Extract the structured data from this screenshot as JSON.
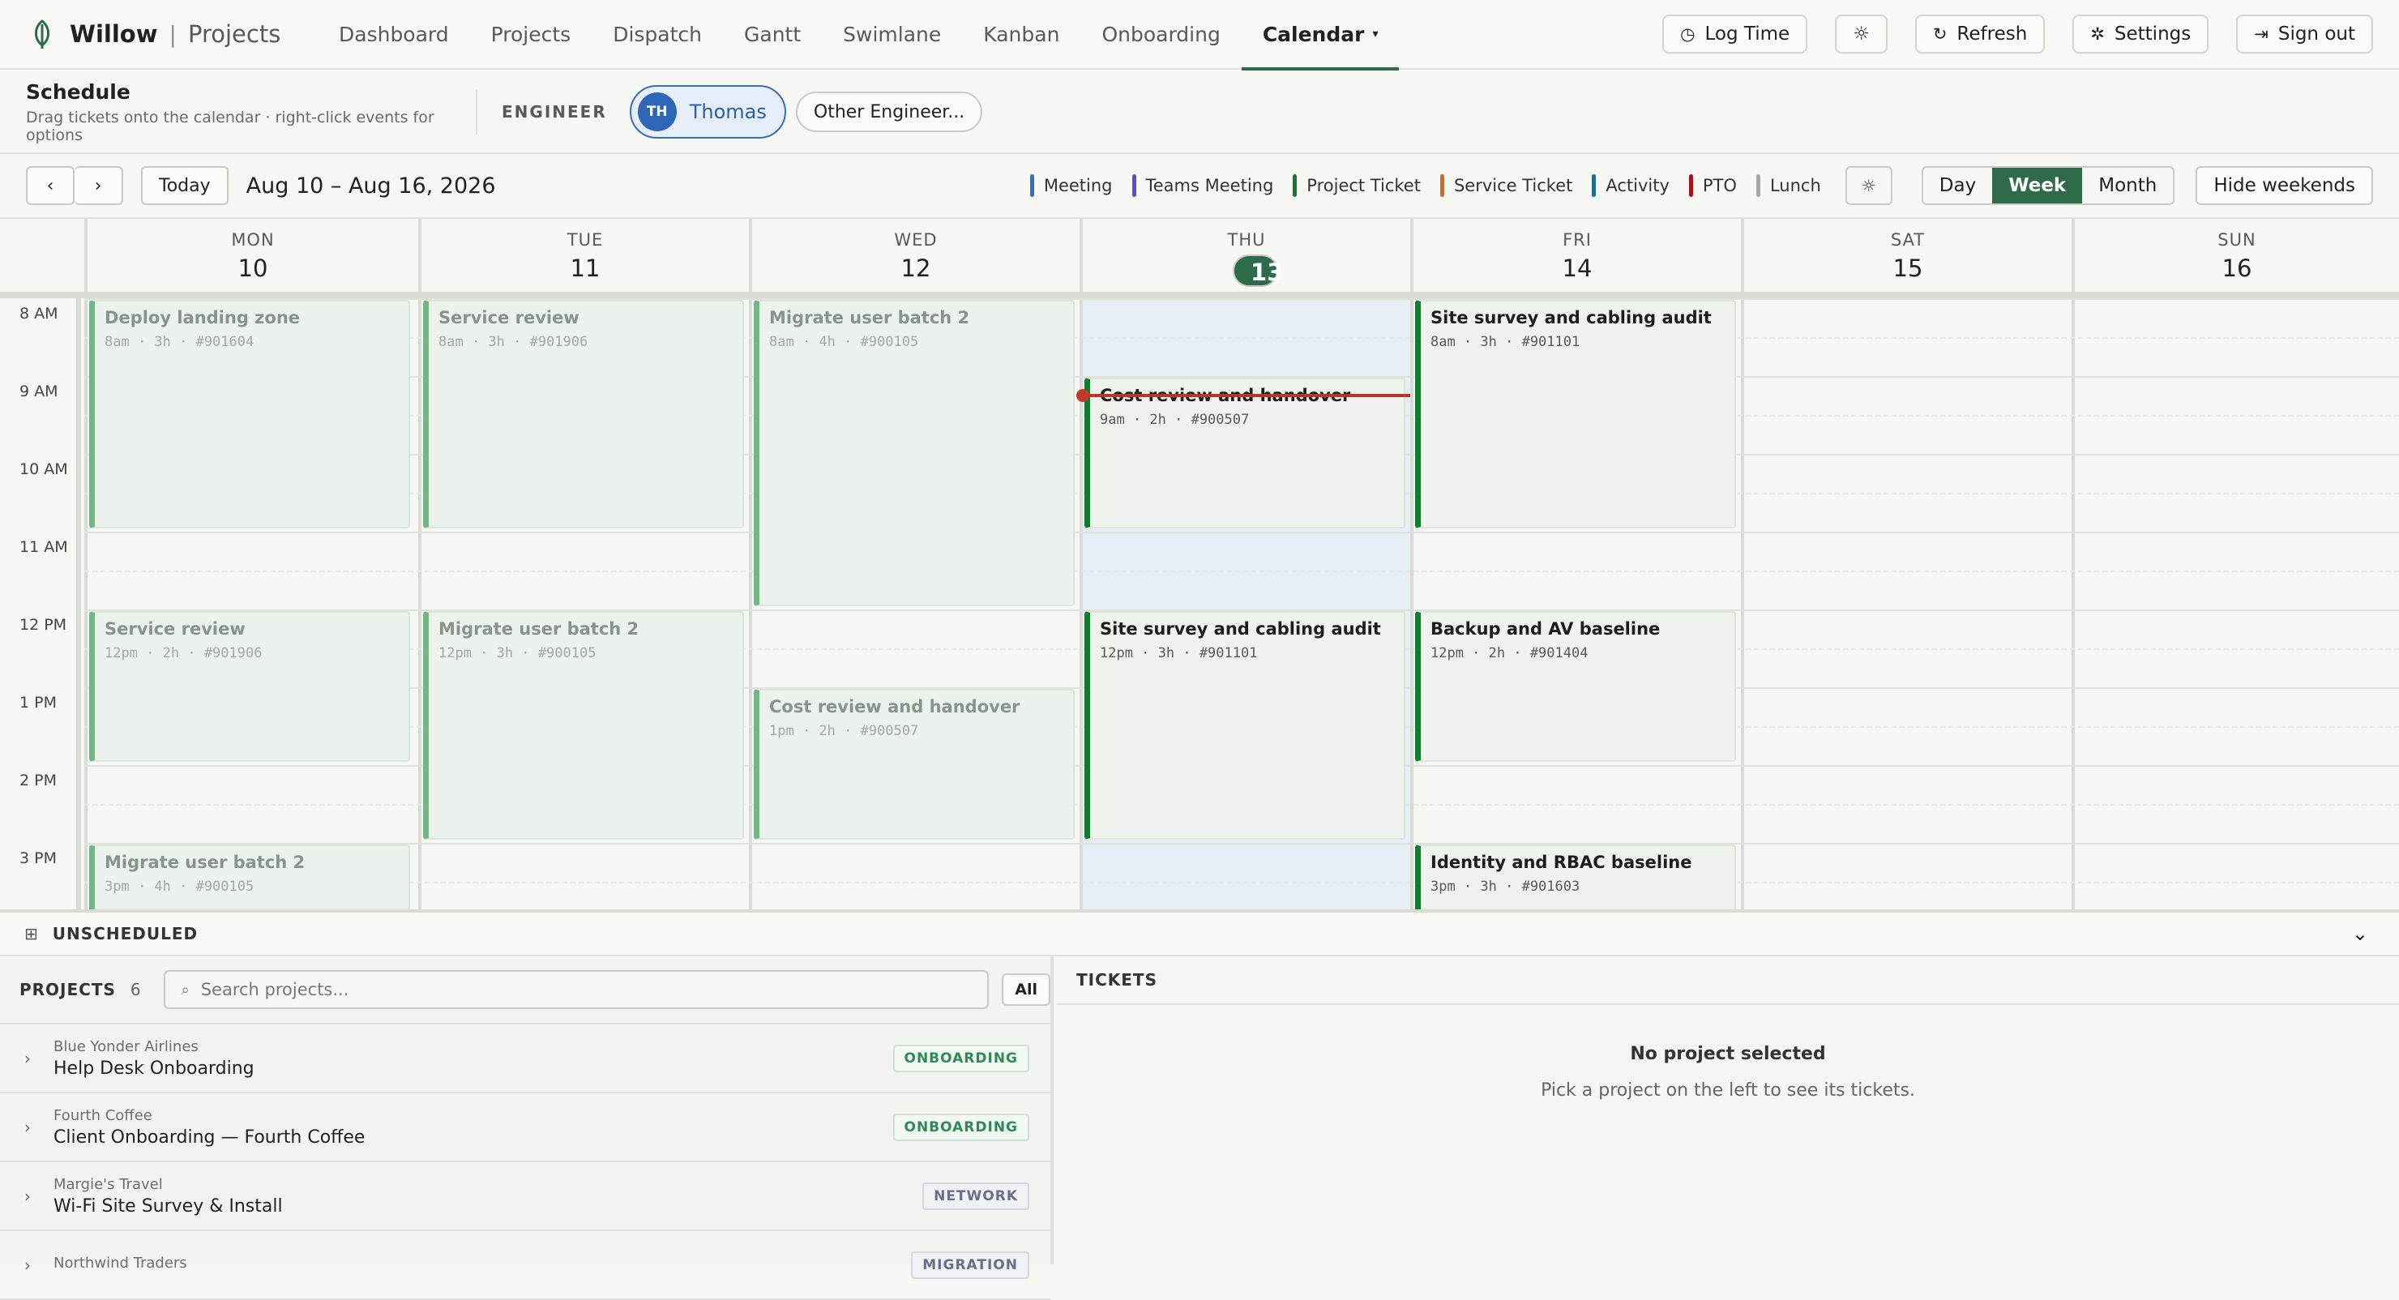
{
  "app": {
    "brand": "Willow",
    "name": "Projects"
  },
  "nav": {
    "tabs": [
      "Dashboard",
      "Projects",
      "Dispatch",
      "Gantt",
      "Swimlane",
      "Kanban",
      "Onboarding",
      "Calendar"
    ],
    "active": "Calendar"
  },
  "topbar": {
    "log_time": "Log Time",
    "refresh": "Refresh",
    "settings": "Settings",
    "sign_out": "Sign out"
  },
  "schedule": {
    "title": "Schedule",
    "subtitle": "Drag tickets onto the calendar · right-click events for options",
    "engineer_label": "ENGINEER",
    "engineer_initials": "TH",
    "engineer_name": "Thomas",
    "other": "Other Engineer..."
  },
  "calendar": {
    "today": "Today",
    "range": "Aug 10 – Aug 16, 2026",
    "legend": [
      {
        "label": "Meeting",
        "color": "#2f6fd1"
      },
      {
        "label": "Teams Meeting",
        "color": "#5b4fd0"
      },
      {
        "label": "Project Ticket",
        "color": "#137a2e"
      },
      {
        "label": "Service Ticket",
        "color": "#d9661f"
      },
      {
        "label": "Activity",
        "color": "#1f6f8b"
      },
      {
        "label": "PTO",
        "color": "#a3121f"
      },
      {
        "label": "Lunch",
        "color": "#a8a8a8"
      }
    ],
    "views": [
      "Day",
      "Week",
      "Month"
    ],
    "active_view": "Week",
    "hide_weekends": "Hide weekends",
    "days": [
      {
        "name": "MON",
        "date": "10"
      },
      {
        "name": "TUE",
        "date": "11"
      },
      {
        "name": "WED",
        "date": "12"
      },
      {
        "name": "THU",
        "date": "13",
        "today": true
      },
      {
        "name": "FRI",
        "date": "14"
      },
      {
        "name": "SAT",
        "date": "15"
      },
      {
        "name": "SUN",
        "date": "16"
      }
    ],
    "hours": [
      "8 AM",
      "9 AM",
      "10 AM",
      "11 AM",
      "12 PM",
      "1 PM",
      "2 PM",
      "3 PM"
    ],
    "events": [
      {
        "day": 0,
        "start": 8,
        "dur": 3,
        "title": "Deploy landing zone",
        "meta": "8am · 3h · #901604",
        "past": true
      },
      {
        "day": 0,
        "start": 12,
        "dur": 2,
        "title": "Service review",
        "meta": "12pm · 2h · #901906",
        "past": true
      },
      {
        "day": 0,
        "start": 15,
        "dur": 4,
        "title": "Migrate user batch 2",
        "meta": "3pm · 4h · #900105",
        "past": true
      },
      {
        "day": 1,
        "start": 8,
        "dur": 3,
        "title": "Service review",
        "meta": "8am · 3h · #901906",
        "past": true
      },
      {
        "day": 1,
        "start": 12,
        "dur": 3,
        "title": "Migrate user batch 2",
        "meta": "12pm · 3h · #900105",
        "past": true
      },
      {
        "day": 2,
        "start": 8,
        "dur": 4,
        "title": "Migrate user batch 2",
        "meta": "8am · 4h · #900105",
        "past": true
      },
      {
        "day": 2,
        "start": 13,
        "dur": 2,
        "title": "Cost review and handover",
        "meta": "1pm · 2h · #900507",
        "past": true
      },
      {
        "day": 3,
        "start": 9,
        "dur": 2,
        "title": "Cost review and handover",
        "meta": "9am · 2h · #900507",
        "past": false
      },
      {
        "day": 3,
        "start": 12,
        "dur": 3,
        "title": "Site survey and cabling audit",
        "meta": "12pm · 3h · #901101",
        "past": false
      },
      {
        "day": 4,
        "start": 8,
        "dur": 3,
        "title": "Site survey and cabling audit",
        "meta": "8am · 3h · #901101",
        "past": false
      },
      {
        "day": 4,
        "start": 12,
        "dur": 2,
        "title": "Backup and AV baseline",
        "meta": "12pm · 2h · #901404",
        "past": false
      },
      {
        "day": 4,
        "start": 15,
        "dur": 3,
        "title": "Identity and RBAC baseline",
        "meta": "3pm · 3h · #901603",
        "past": false
      }
    ],
    "now_hour": 9.25
  },
  "unscheduled": {
    "label": "UNSCHEDULED"
  },
  "projects": {
    "title": "PROJECTS",
    "count": "6",
    "search_placeholder": "Search projects...",
    "all": "All",
    "items": [
      {
        "org": "Blue Yonder Airlines",
        "name": "Help Desk Onboarding",
        "badge": "ONBOARDING",
        "kind": "on"
      },
      {
        "org": "Fourth Coffee",
        "name": "Client Onboarding — Fourth Coffee",
        "badge": "ONBOARDING",
        "kind": "on"
      },
      {
        "org": "Margie's Travel",
        "name": "Wi-Fi Site Survey & Install",
        "badge": "NETWORK",
        "kind": "net"
      },
      {
        "org": "Northwind Traders",
        "name": "",
        "badge": "MIGRATION",
        "kind": "net"
      }
    ]
  },
  "tickets": {
    "title": "TICKETS",
    "empty_title": "No project selected",
    "empty_sub": "Pick a project on the left to see its tickets."
  }
}
